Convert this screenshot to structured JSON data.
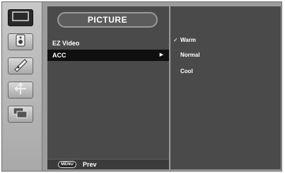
{
  "main_menu": {
    "title": "PICTURE",
    "items": [
      {
        "label": "EZ Video",
        "selected": false
      },
      {
        "label": "ACC",
        "selected": true,
        "submenu_arrow": "▶"
      }
    ],
    "footer": {
      "key_label": "MENU",
      "action_label": "Prev"
    }
  },
  "sidebar": {
    "items": [
      {
        "name": "picture-icon",
        "active": true
      },
      {
        "name": "display-adjust-icon",
        "active": false
      },
      {
        "name": "tracking-icon",
        "active": false
      },
      {
        "name": "position-icon",
        "active": false
      },
      {
        "name": "setup-icon",
        "active": false
      }
    ]
  },
  "submenu": {
    "items": [
      {
        "label": "Warm",
        "checked": true,
        "check_mark": "✓"
      },
      {
        "label": "Normal",
        "checked": false
      },
      {
        "label": "Cool",
        "checked": false
      }
    ]
  },
  "colors": {
    "panel_bg": "#4a4a4a",
    "selected_row": "#0f0f0f",
    "text": "#ffffff"
  }
}
